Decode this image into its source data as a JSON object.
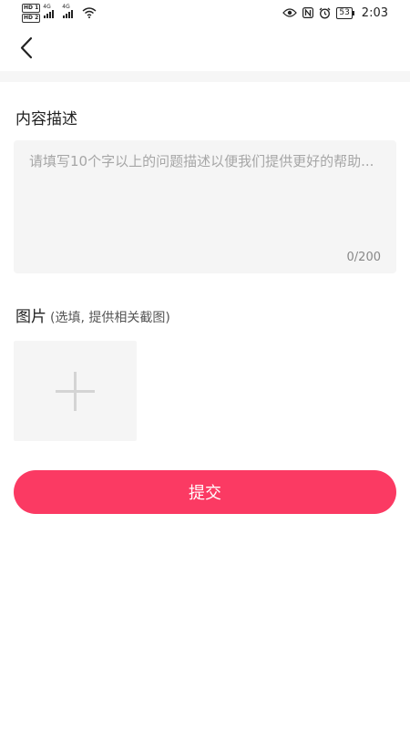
{
  "status_bar": {
    "hd1": "HD 1",
    "hd2": "HD 2",
    "net1": "4G",
    "net2": "4G",
    "battery": "53",
    "time": "2:03"
  },
  "form": {
    "description_title": "内容描述",
    "description_placeholder": "请填写10个字以上的问题描述以便我们提供更好的帮助...",
    "char_counter": "0/200",
    "image_title": "图片",
    "image_hint": "(选填, 提供相关截图)",
    "submit_label": "提交"
  },
  "colors": {
    "accent": "#fb3a63",
    "input_background": "#f5f5f5"
  }
}
